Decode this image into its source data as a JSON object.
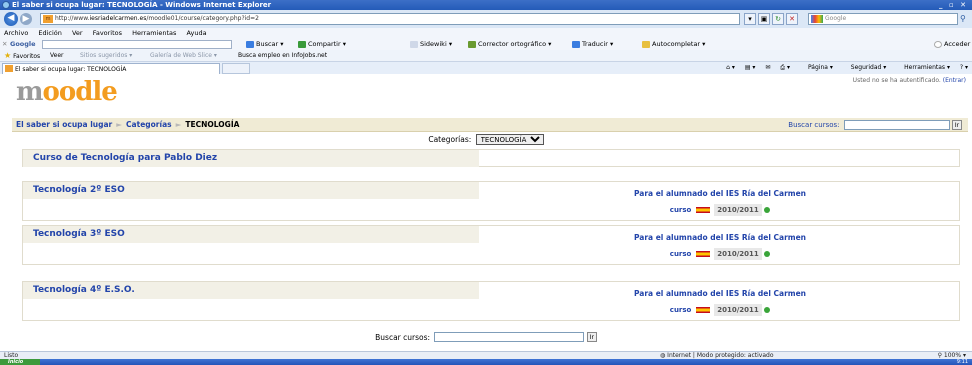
{
  "window": {
    "title": "El saber si ocupa lugar: TECNOLOGÍA - Windows Internet Explorer"
  },
  "address": {
    "prefix": "http://www.",
    "host": "iesriadelcarmen.es",
    "path": "/moodle01/course/category.php?id=2"
  },
  "search_box": {
    "placeholder": "Google"
  },
  "menu": [
    "Archivo",
    "Edición",
    "Ver",
    "Favoritos",
    "Herramientas",
    "Ayuda"
  ],
  "google_toolbar": {
    "label": "Google",
    "items": [
      "Buscar",
      "Compartir",
      "Sidewiki",
      "Corrector ortográfico",
      "Traducir",
      "Autocompletar",
      "Acceder"
    ]
  },
  "favorites": {
    "label": "Favoritos",
    "items": [
      "Veer",
      "Sitios sugeridos",
      "Galería de Web Slice",
      "Busca empleo en InfoJobs.net"
    ]
  },
  "tab": {
    "title": "El saber si ocupa lugar: TECNOLOGÍA"
  },
  "command_bar": [
    "Página",
    "Seguridad",
    "Herramientas"
  ],
  "moodle": {
    "logo": "moodle",
    "login_info": "Usted no se ha autentificado.",
    "login_link": "(Entrar)",
    "breadcrumb": [
      "El saber si ocupa lugar",
      "Categorías",
      "TECNOLOGÍA"
    ],
    "search_label": "Buscar cursos:",
    "search_go": "Ir",
    "categories_label": "Categorías:",
    "categories_selected": "TECNOLOGÍA"
  },
  "courses": [
    {
      "name": "Curso de Tecnología para Pablo Diez"
    },
    {
      "name": "Tecnología 2º ESO",
      "audience": "Para el alumnado del IES Ría del Carmen",
      "prefix": "curso",
      "year": "2010/2011"
    },
    {
      "name": "Tecnología 3º ESO",
      "audience": "Para el alumnado del IES Ría del Carmen",
      "prefix": "curso",
      "year": "2010/2011"
    },
    {
      "name": "Tecnología 4º E.S.O.",
      "audience": "Para el alumnado del IES Ría del Carmen",
      "prefix": "curso",
      "year": "2010/2011"
    }
  ],
  "status": {
    "left": "Listo",
    "zone": "Internet | Modo protegido: activado",
    "zoom": "100%"
  },
  "taskbar": {
    "start": "Inicio",
    "clock": "9:11"
  }
}
